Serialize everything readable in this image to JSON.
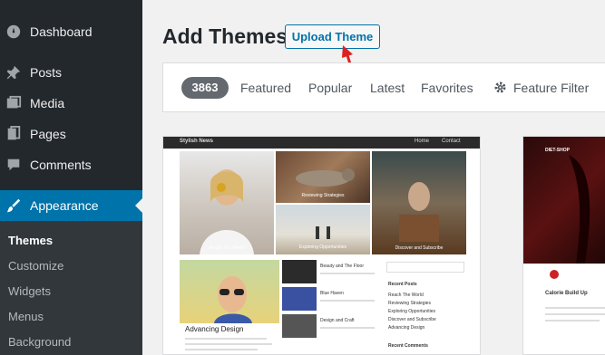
{
  "sidebar": {
    "items": [
      {
        "label": "Dashboard",
        "icon": "dashboard-icon"
      },
      {
        "label": "Posts",
        "icon": "pin-icon"
      },
      {
        "label": "Media",
        "icon": "media-icon"
      },
      {
        "label": "Pages",
        "icon": "pages-icon"
      },
      {
        "label": "Comments",
        "icon": "comments-icon"
      },
      {
        "label": "Appearance",
        "icon": "brush-icon"
      }
    ],
    "submenu": [
      "Themes",
      "Customize",
      "Widgets",
      "Menus",
      "Background"
    ]
  },
  "main": {
    "title": "Add Themes",
    "upload_button": "Upload Theme",
    "filter": {
      "count": "3863",
      "tabs": [
        "Featured",
        "Popular",
        "Latest",
        "Favorites"
      ],
      "feature_filter": "Feature Filter"
    }
  },
  "preview1": {
    "site_title": "Stylish News",
    "nav": [
      "Home",
      "Contact"
    ],
    "captions": [
      "Reach The World",
      "Reviewing Strategies",
      "Exploring Opportunities",
      "Discover and Subscribe"
    ],
    "posts": [
      "Beauty and The Floor",
      "Blue Haven",
      "Design and Craft"
    ],
    "sidebar_heading": "Recent Posts",
    "sidebar_links": [
      "Reach The World",
      "Reviewing Strategies",
      "Exploring Opportunities",
      "Discover and Subscribe",
      "Advancing Design"
    ],
    "recent_comments": "Recent Comments",
    "featured_title": "Advancing Design"
  },
  "preview2": {
    "logo": "DIET-SHOP",
    "product": "Calorie Build Up"
  },
  "colors": {
    "sidebar_bg": "#23282d",
    "active_bg": "#0073aa",
    "accent": "#0073aa",
    "arrow": "#e02020"
  }
}
